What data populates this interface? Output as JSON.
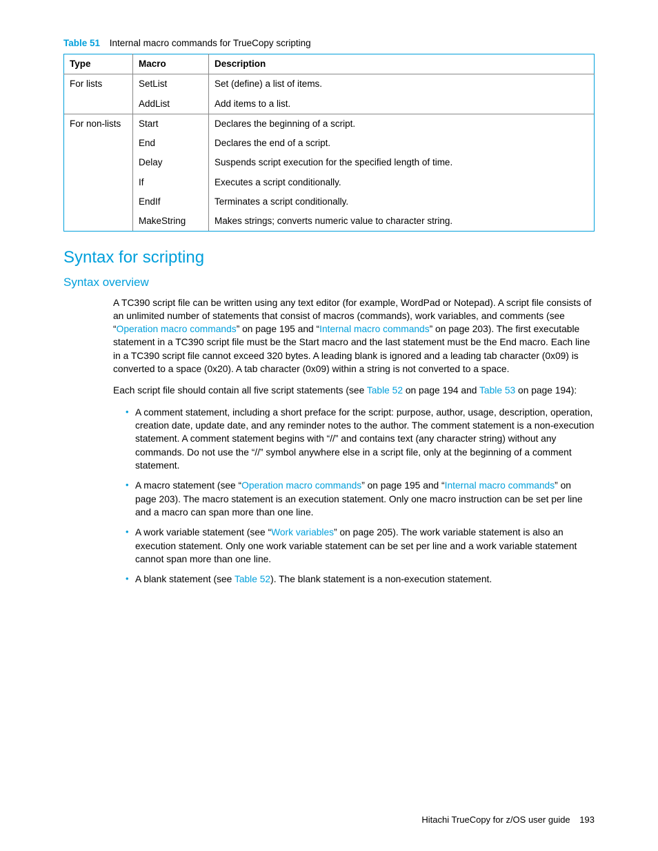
{
  "table": {
    "label": "Table 51",
    "caption": "Internal macro commands for TrueCopy scripting",
    "headers": {
      "type": "Type",
      "macro": "Macro",
      "description": "Description"
    },
    "groups": [
      {
        "type": "For lists",
        "rows": [
          {
            "macro": "SetList",
            "desc": "Set (define) a list of items."
          },
          {
            "macro": "AddList",
            "desc": "Add items to a list."
          }
        ]
      },
      {
        "type": "For non-lists",
        "rows": [
          {
            "macro": "Start",
            "desc": "Declares the beginning of a script."
          },
          {
            "macro": "End",
            "desc": "Declares the end of a script."
          },
          {
            "macro": "Delay",
            "desc": "Suspends script execution for the specified length of time."
          },
          {
            "macro": "If",
            "desc": "Executes a script conditionally."
          },
          {
            "macro": "EndIf",
            "desc": "Terminates a script conditionally."
          },
          {
            "macro": "MakeString",
            "desc": "Makes strings; converts numeric value to character string."
          }
        ]
      }
    ]
  },
  "h2": "Syntax for scripting",
  "h3": "Syntax overview",
  "p1": {
    "t1": "A TC390 script file can be written using any text editor (for example, WordPad or Notepad). A script file consists of an unlimited number of statements that consist of macros (commands), work variables, and comments (see “",
    "l1": "Operation macro commands",
    "t2": "” on page 195 and “",
    "l2": "Internal macro commands",
    "t3": "” on page 203). The first executable statement in a TC390 script file must be the Start macro and the last statement must be the End macro. Each line in a TC390 script file cannot exceed 320 bytes. A leading blank is ignored and a leading tab character (0x09) is converted to a space (0x20). A tab character (0x09) within a string is not converted to a space."
  },
  "p2": {
    "t1": "Each script file should contain all five script statements (see ",
    "l1": "Table 52",
    "t2": " on page 194 and ",
    "l2": "Table 53",
    "t3": " on page 194):"
  },
  "bullets": {
    "b1": "A comment statement, including a short preface for the script: purpose, author, usage, description, operation, creation date, update date, and any reminder notes to the author. The comment statement is a non-execution statement. A comment statement begins with “//” and contains text (any character string) without any commands. Do not use the “//” symbol anywhere else in a script file, only at the beginning of a comment statement.",
    "b2": {
      "t1": "A macro statement (see “",
      "l1": "Operation macro commands",
      "t2": "” on page 195 and “",
      "l2": "Internal macro commands",
      "t3": "” on page 203). The macro statement is an execution statement. Only one macro instruction can be set per line and a macro can span more than one line."
    },
    "b3": {
      "t1": "A work variable statement (see “",
      "l1": "Work variables",
      "t2": "” on page 205). The work variable statement is also an execution statement. Only one work variable statement can be set per line and a work variable statement cannot span more than one line."
    },
    "b4": {
      "t1": "A blank statement (see ",
      "l1": "Table 52",
      "t2": "). The blank statement is a non-execution statement."
    }
  },
  "footer": {
    "title": "Hitachi TrueCopy for z/OS user guide",
    "page": "193"
  }
}
